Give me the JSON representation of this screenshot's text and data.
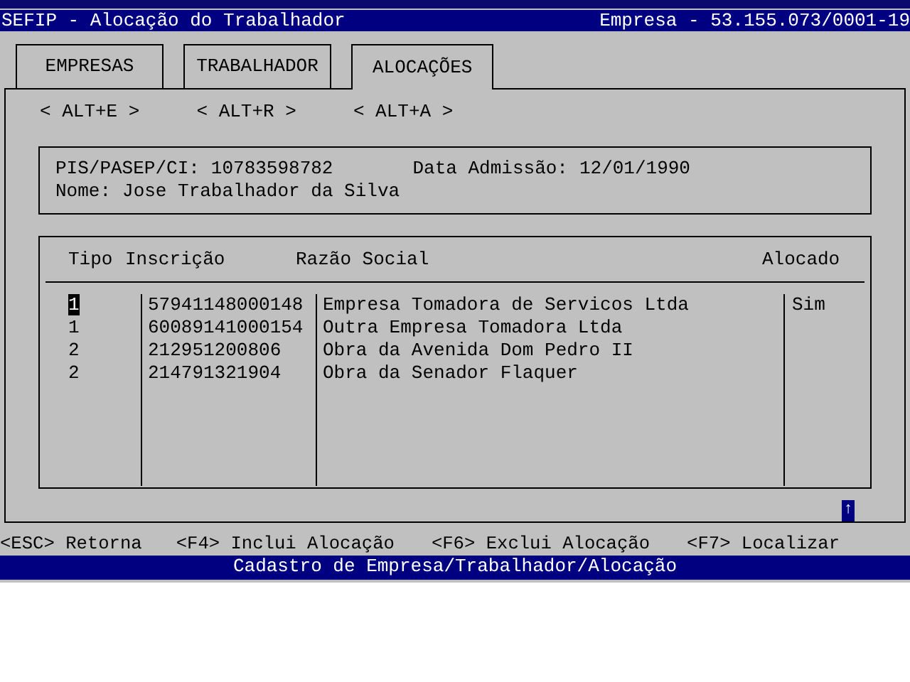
{
  "window": {
    "title": "SEFIP - Alocação do Trabalhador",
    "company": "Empresa - 53.155.073/0001-19"
  },
  "tabs": [
    {
      "label": "EMPRESAS",
      "selected": false
    },
    {
      "label": "TRABALHADOR",
      "selected": false
    },
    {
      "label": "ALOCAÇÕES",
      "selected": true
    }
  ],
  "shortcuts": [
    "< ALT+E >",
    "< ALT+R >",
    "< ALT+A >"
  ],
  "worker": {
    "pis_label": "PIS/PASEP/CI:",
    "pis": "10783598782",
    "admission_label": "Data Admissão:",
    "admission": "12/01/1990",
    "name_label": "Nome:",
    "name": "Jose Trabalhador da Silva"
  },
  "table": {
    "columns": [
      "Tipo",
      "Inscrição",
      "Razão Social",
      "Alocado"
    ],
    "rows": [
      {
        "tipo": "1",
        "inscricao": "57941148000148",
        "razao": "Empresa Tomadora de Servicos Ltda",
        "alocado": "Sim",
        "selected": true
      },
      {
        "tipo": "1",
        "inscricao": "60089141000154",
        "razao": "Outra Empresa Tomadora Ltda",
        "alocado": "",
        "selected": false
      },
      {
        "tipo": "2",
        "inscricao": "212951200806",
        "razao": "Obra da Avenida Dom Pedro II",
        "alocado": "",
        "selected": false
      },
      {
        "tipo": "2",
        "inscricao": "214791321904",
        "razao": "Obra da Senador Flaquer",
        "alocado": "",
        "selected": false
      }
    ]
  },
  "scroll_indicator": "↑",
  "function_keys": [
    "<ESC> Retorna",
    "<F4> Inclui Alocação",
    "<F6> Exclui Alocação",
    "<F7> Localizar"
  ],
  "status_bar": "Cadastro de Empresa/Trabalhador/Alocação"
}
